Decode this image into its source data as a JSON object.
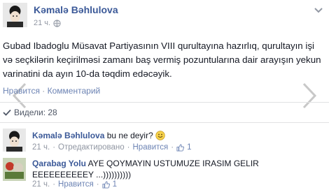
{
  "post": {
    "author": "Kəmalə Bəhlulova",
    "time": "21 ч.",
    "text": "Gubad Ibadoglu Müsavat Partiyasının VIII qurultayına hazırlıq, qurultayın işi və seçkilərin keçirilməsi zamanı baş vermiş pozuntularına dair arayışın yekun varinatini da ayın 10-da təqdim edəcəyik.",
    "like_label": "Нравится",
    "separator": "·",
    "comment_label": "Комментарий",
    "seen_label": "Видели: 28"
  },
  "comments": [
    {
      "author": "Kəmalə Bəhlulova",
      "text": "bu ne deyir?",
      "time": "21 ч.",
      "edited_label": "Отредактировано",
      "like_label": "Нравится",
      "like_count": "1"
    },
    {
      "author": "Qarabag Yolu",
      "text": "AYE QOYMAYIN USTUMUZE IRASIM GELIR EEEEEEEEEEY ...))))))))))",
      "time": "21 ч.",
      "like_label": "Нравится",
      "like_count": "1"
    }
  ],
  "icons": {
    "globe": "globe-icon",
    "chevron": "chevron-down-icon",
    "check": "check-icon",
    "like": "thumbs-up-icon",
    "prev": "arrow-left-icon",
    "next": "arrow-right-icon"
  },
  "colors": {
    "link": "#3b5998",
    "secondary_link": "#6d84b4",
    "meta": "#9197a3"
  }
}
